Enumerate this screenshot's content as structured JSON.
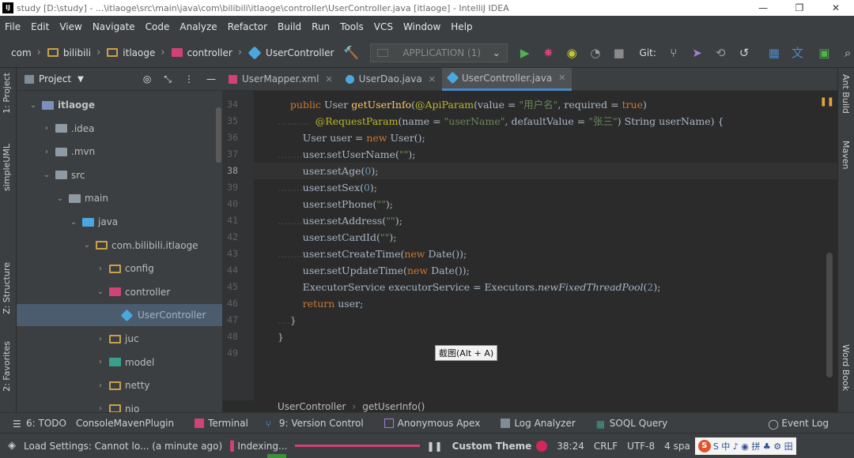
{
  "window": {
    "title": "study [D:\\study] - ...\\itlaoge\\src\\main\\java\\com\\bilibili\\itlaoge\\controller\\UserController.java [itlaoge] - IntelliJ IDEA",
    "app_logo": "IJ",
    "controls": [
      "—",
      "❐",
      "✕"
    ]
  },
  "menu": [
    "File",
    "Edit",
    "View",
    "Navigate",
    "Code",
    "Analyze",
    "Refactor",
    "Build",
    "Run",
    "Tools",
    "VCS",
    "Window",
    "Help"
  ],
  "navbar": {
    "crumbs": [
      "com",
      "bilibili",
      "itlaoge",
      "controller",
      "UserController"
    ],
    "run_config": "APPLICATION (1)",
    "git_label": "Git:"
  },
  "left_strip": [
    "1: Project",
    "simpleUML",
    "Z: Structure",
    "2: Favorites"
  ],
  "right_strip": [
    "Ant Build",
    "Maven",
    "Word Book"
  ],
  "project": {
    "header": "Project",
    "tree": [
      {
        "label": "itlaoge",
        "depth": 0,
        "expanded": true,
        "icon": "module"
      },
      {
        "label": ".idea",
        "depth": 1,
        "expanded": false,
        "icon": "grey"
      },
      {
        "label": ".mvn",
        "depth": 1,
        "expanded": false,
        "icon": "grey"
      },
      {
        "label": "src",
        "depth": 1,
        "expanded": true,
        "icon": "grey"
      },
      {
        "label": "main",
        "depth": 2,
        "expanded": true,
        "icon": "grey"
      },
      {
        "label": "java",
        "depth": 3,
        "expanded": true,
        "icon": "blue"
      },
      {
        "label": "com.bilibili.itlaoge",
        "depth": 4,
        "expanded": true,
        "icon": "yellow"
      },
      {
        "label": "config",
        "depth": 5,
        "expanded": false,
        "icon": "yellow"
      },
      {
        "label": "controller",
        "depth": 5,
        "expanded": true,
        "icon": "pink"
      },
      {
        "label": "UserController",
        "depth": 6,
        "expanded": null,
        "icon": "class",
        "selected": true
      },
      {
        "label": "juc",
        "depth": 5,
        "expanded": false,
        "icon": "yellow"
      },
      {
        "label": "model",
        "depth": 5,
        "expanded": false,
        "icon": "teal"
      },
      {
        "label": "netty",
        "depth": 5,
        "expanded": false,
        "icon": "yellow"
      },
      {
        "label": "nio",
        "depth": 5,
        "expanded": false,
        "icon": "yellow"
      }
    ]
  },
  "editor": {
    "tabs": [
      {
        "label": "UserMapper.xml",
        "active": false
      },
      {
        "label": "UserDao.java",
        "active": false
      },
      {
        "label": "UserController.java",
        "active": true
      }
    ],
    "line_numbers": [
      "34",
      "35",
      "36",
      "37",
      "38",
      "39",
      "40",
      "41",
      "42",
      "43",
      "44",
      "45",
      "46",
      "47",
      "48",
      "49"
    ],
    "current_line": "38",
    "breadcrumb": [
      "UserController",
      "getUserInfo()"
    ],
    "tooltip": "截图(Alt + A)"
  },
  "bottom_tools": [
    "6: TODO",
    "ConsoleMavenPlugin",
    "Terminal",
    "9: Version Control",
    "Anonymous Apex",
    "Log Analyzer",
    "SOQL Query"
  ],
  "event_log": "Event Log",
  "status": {
    "message": "Load Settings: Cannot lo... (a minute ago)",
    "indexing": "Indexing...",
    "theme": "Custom Theme",
    "position": "38:24",
    "line_sep": "CRLF",
    "encoding": "UTF-8",
    "indent": "4 spa",
    "watermark": "S 中 ♪ ◉ 拼 ♣ ⚙ 田"
  },
  "colors": {
    "accent": "#4a88c7",
    "brand": "#d04374"
  }
}
